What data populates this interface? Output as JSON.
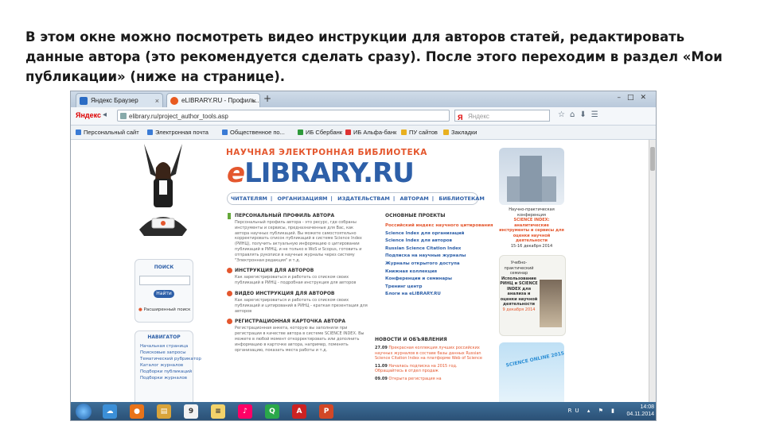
{
  "caption": "В этом окне можно посмотреть видео инструкции для авторов статей, редактировать данные автора (это рекомендуется сделать сразу). После этого переходим в раздел «Мои публикации» (ниже на странице).",
  "browser": {
    "tabs": [
      {
        "label": "Яндекс Браузер"
      },
      {
        "label": "eLIBRARY.RU - Профиль..."
      }
    ],
    "new_tab": "+",
    "url": "elibrary.ru/project_author_tools.asp",
    "search_placeholder": "Яндекс",
    "search_brand": "Я",
    "yandex_label": "Яндекс",
    "bookmarks": [
      "Персональный сайт",
      "Электронная почта",
      "Общественное по...",
      "ИБ Сбербанк",
      "ИБ Альфа-банк",
      "ПУ сайтов",
      "Закладки"
    ]
  },
  "page": {
    "banner": "НАУЧНАЯ ЭЛЕКТРОННАЯ БИБЛИОТЕКА",
    "logo_e": "e",
    "logo_rest": "LIBRARY.RU",
    "topnav": [
      "ЧИТАТЕЛЯМ",
      "ОРГАНИЗАЦИЯМ",
      "ИЗДАТЕЛЬСТВАМ",
      "АВТОРАМ",
      "БИБЛИОТЕКАМ"
    ],
    "login": {
      "title": "ПОИСК",
      "button": "Найти",
      "link": "Расширенный поиск"
    },
    "navigator": {
      "title": "НАВИГАТОР",
      "items": [
        "Начальная страница",
        "Поисковые запросы",
        "Тематический рубрикатор",
        "Каталог журналов",
        "Подборки публикаций",
        "Подборки журналов"
      ]
    },
    "sections": [
      {
        "title": "ПЕРСОНАЛЬНЫЙ ПРОФИЛЬ АВТОРА",
        "text": "Персональный профиль автора - это ресурс, где собраны инструменты и сервисы, предназначенные для Вас, как автора научных публикаций. Вы можете самостоятельно корректировать список публикаций в системе Science Index (РИНЦ), получить актуальную информацию о цитировании публикаций в РИНЦ, и не только в WoS и Scopus, готовить и отправлять рукописи в научные журналы через систему \"Электронная редакция\" и т.д."
      },
      {
        "title": "ИНСТРУКЦИЯ ДЛЯ АВТОРОВ",
        "text": "Как зарегистрироваться и работать со списком своих публикаций в РИНЦ - подробная инструкция для авторов"
      },
      {
        "title": "ВИДЕО ИНСТРУКЦИЯ ДЛЯ АВТОРОВ",
        "text": "Как зарегистрироваться и работать со списком своих публикаций и цитирований в РИНЦ - краткая презентация для авторов"
      },
      {
        "title": "РЕГИСТРАЦИОННАЯ КАРТОЧКА АВТОРА",
        "text": "Регистрационная анкета, которую вы заполнили при регистрации в качестве автора в системе SCIENCE INDEX. Вы можете в любой момент откорректировать или дополнить информацию в карточке автора, например, поменять организацию, показать места работы и т.д."
      }
    ],
    "projects": {
      "title": "ОСНОВНЫЕ ПРОЕКТЫ",
      "items": [
        {
          "label": "Российский индекс научного цитирования",
          "highlight": true
        },
        {
          "label": "Science Index для организаций",
          "highlight": false
        },
        {
          "label": "Science Index для авторов",
          "highlight": false
        },
        {
          "label": "Russian Science Citation Index",
          "highlight": false
        },
        {
          "label": "Подписка на научные журналы",
          "highlight": false
        },
        {
          "label": "Журналы открытого доступа",
          "highlight": false
        },
        {
          "label": "Книжная коллекция",
          "highlight": false
        },
        {
          "label": "Конференции и семинары",
          "highlight": false
        },
        {
          "label": "Тренинг центр",
          "highlight": false
        },
        {
          "label": "Блоги на eLIBRARY.RU",
          "highlight": false
        }
      ]
    },
    "news": {
      "title": "НОВОСТИ И ОБЪЯВЛЕНИЯ",
      "items": [
        {
          "date": "27.09",
          "text": "Прекрасная коллекция лучших российских научных журналов в составе базы данных Russian Science Citation Index на платформе Web of Science"
        },
        {
          "date": "11.09",
          "text": "Началась подписка на 2015 год. Обращайтесь в отдел продаж"
        },
        {
          "date": "09.09",
          "text": "Открыта регистрация на"
        }
      ]
    },
    "right": {
      "promo1": "Научно-практическая конференция",
      "promo1_red": "SCIENCE INDEX: аналитические инструменты и сервисы для оценки научной деятельности",
      "promo1_date": "15-16 декабря 2014",
      "promo2_title": "Учебно-практический семинар",
      "promo2_body": "Использование РИНЦ и SCIENCE INDEX для анализа и оценки научной деятельности",
      "promo2_date": "9 декабря 2014",
      "promo3": "SCIENCE ONLINE 2015"
    }
  },
  "taskbar": {
    "lang": "RU",
    "time": "14:08",
    "date": "04.11.2014",
    "apps": [
      "cloud",
      "firefox",
      "files",
      "9",
      "notes",
      "itunes",
      "q",
      "a",
      "p"
    ]
  }
}
